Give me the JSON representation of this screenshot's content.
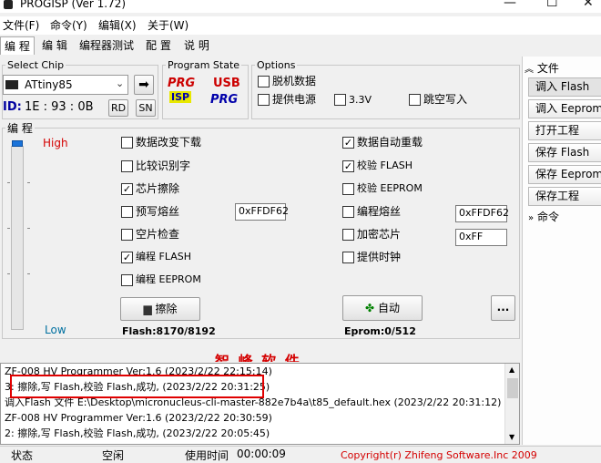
{
  "window": {
    "title": "PROGISP (Ver 1.72)",
    "minimize": "—",
    "maximize": "☐",
    "close": "✕"
  },
  "menu": [
    "文件(F)",
    "命令(Y)",
    "编辑(X)",
    "关于(W)"
  ],
  "tabs": [
    "编 程",
    "编 辑",
    "编程器测试",
    "配 置",
    "说 明"
  ],
  "select_chip": {
    "label": "Select Chip",
    "value": "ATtiny85",
    "id_label": "ID:",
    "id_value": "1E : 93 : 0B",
    "rd": "RD",
    "sn": "SN"
  },
  "program_state": {
    "label": "Program State",
    "prg": "PRG",
    "isp": "ISP",
    "usb": "USB",
    "prg2": "PRG"
  },
  "options": {
    "label": "Options",
    "items": [
      {
        "label": "脱机数据",
        "checked": false
      },
      {
        "label": "提供电源",
        "checked": false
      },
      {
        "label": "3.3V",
        "checked": false
      },
      {
        "label": "跳空写入",
        "checked": false
      }
    ]
  },
  "program": {
    "label": "编 程",
    "slider_high": "High",
    "slider_low": "Low",
    "left_checks": [
      {
        "label": "数据改变下载",
        "checked": false
      },
      {
        "label": "比较识别字",
        "checked": false
      },
      {
        "label": "芯片擦除",
        "checked": true
      },
      {
        "label": "预写熔丝",
        "checked": false
      },
      {
        "label": "空片检查",
        "checked": false
      },
      {
        "label": "编程 FLASH",
        "checked": true
      },
      {
        "label": "编程 EEPROM",
        "checked": false
      }
    ],
    "right_checks": [
      {
        "label": "数据自动重载",
        "checked": true
      },
      {
        "label": "校验 FLASH",
        "checked": true
      },
      {
        "label": "校验 EEPROM",
        "checked": false
      },
      {
        "label": "编程熔丝",
        "checked": false
      },
      {
        "label": "加密芯片",
        "checked": false
      },
      {
        "label": "提供时钟",
        "checked": false
      }
    ],
    "fuse_left": "0xFFDF62",
    "fuse_right": "0xFFDF62",
    "lock_value": "0xFF",
    "erase_button": "擦除",
    "auto_button": "自动",
    "more_button": "...",
    "flash_info": "Flash:8170/8192",
    "eprom_info": "Eprom:0/512"
  },
  "banner": "智 峰 软 件",
  "log": [
    "ZF-008 HV Programmer Ver:1.6 (2023/2/22 22:15:14)",
    "3: 擦除,写 Flash,校验 Flash,成功, (2023/2/22 20:31:25)",
    "调入Flash 文件 E:\\Desktop\\micronucleus-cli-master-882e7b4a\\t85_default.hex (2023/2/22 20:31:12)",
    "ZF-008 HV Programmer Ver:1.6 (2023/2/22 20:30:59)",
    "2: 擦除,写 Flash,校验 Flash,成功, (2023/2/22 20:05:45)"
  ],
  "sidebar": {
    "file_header": "文件",
    "buttons": [
      "调入 Flash",
      "调入 Eeprom",
      "打开工程",
      "保存 Flash",
      "保存 Eeprom",
      "保存工程"
    ],
    "cmd_header": "命令"
  },
  "status": {
    "state_label": "状态",
    "state_value": "空闲",
    "time_label": "使用时间",
    "time_value": "00:00:09",
    "copyright": "Copyright(r) Zhifeng Software.Inc 2009"
  },
  "colors": {
    "accent_red": "#d40000",
    "highlight_box": "#e00000",
    "id_blue": "#0000a0"
  }
}
